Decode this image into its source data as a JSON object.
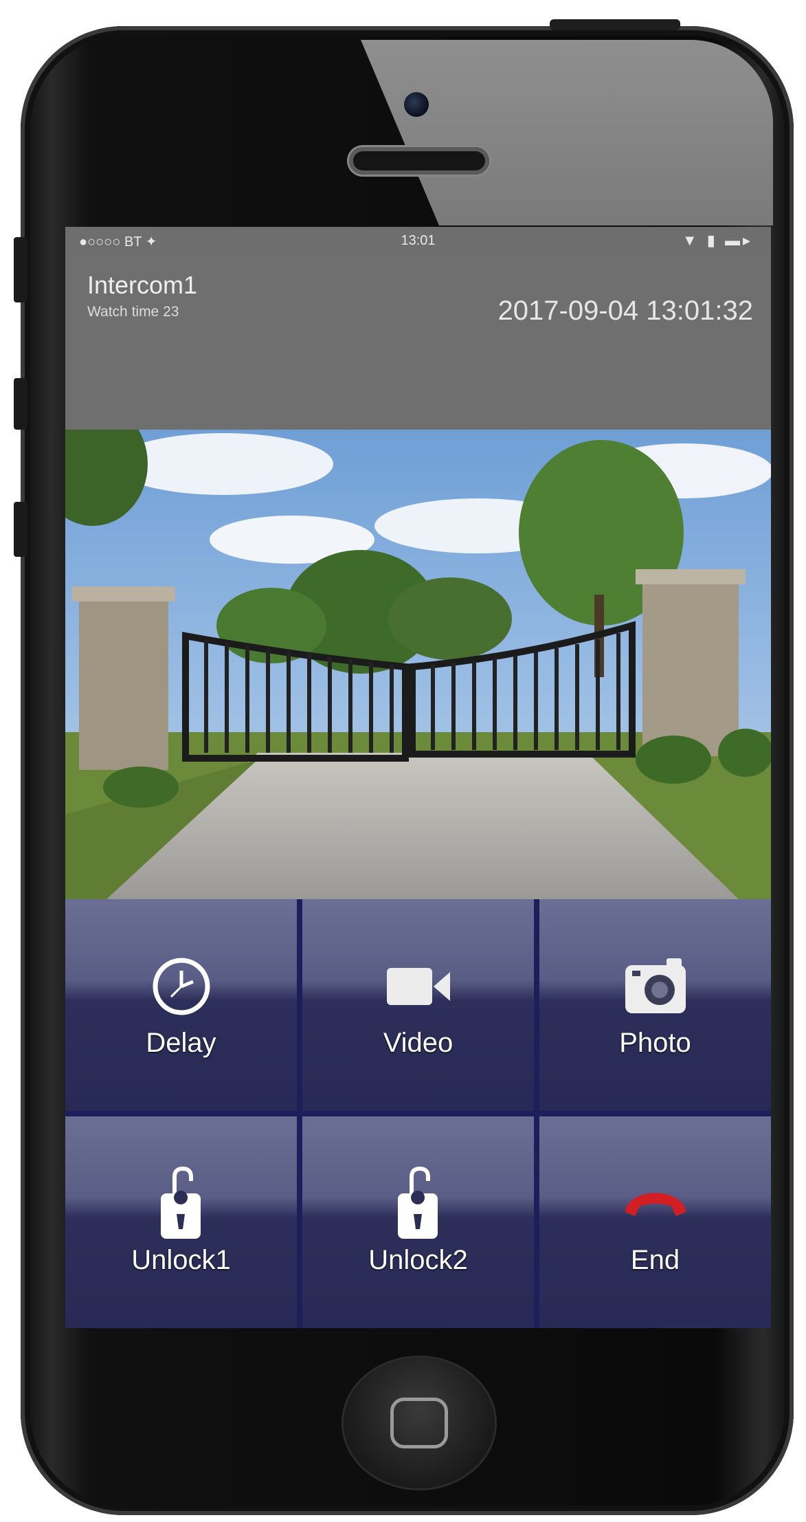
{
  "status_bar": {
    "carrier": "●○○○○ BT ✦",
    "time": "13:01",
    "indicators": "▼ ▮ ▬▸"
  },
  "header": {
    "device_name": "Intercom1",
    "watch_time": "Watch time 23",
    "datetime": "2017-09-04 13:01:32"
  },
  "controls": [
    {
      "label": "Delay",
      "icon": "clock-icon"
    },
    {
      "label": "Video",
      "icon": "video-camera-icon"
    },
    {
      "label": "Photo",
      "icon": "photo-camera-icon"
    },
    {
      "label": "Unlock1",
      "icon": "unlock-icon"
    },
    {
      "label": "Unlock2",
      "icon": "unlock-icon"
    },
    {
      "label": "End",
      "icon": "end-call-icon"
    }
  ],
  "colors": {
    "header_bg": "#6f6f6f",
    "control_bg": "#282a55",
    "end_call": "#d21f24"
  }
}
